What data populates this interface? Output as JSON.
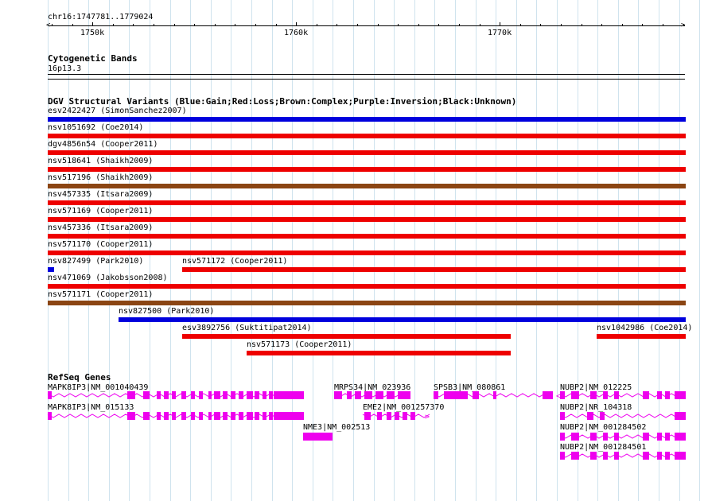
{
  "position": "chr16:1747781..1779024",
  "ruler": {
    "labels": [
      "1750k",
      "1760k",
      "1770k"
    ]
  },
  "cytoband": {
    "title": "Cytogenetic Bands",
    "band": "16p13.3"
  },
  "dgv": {
    "title": "DGV Structural Variants (Blue:Gain;Red:Loss;Brown:Complex;Purple:Inversion;Black:Unknown)",
    "colors": {
      "gain": "#0000dd",
      "loss": "#ee0000",
      "complex": "#8b4513"
    },
    "variants": [
      {
        "label": "esv2422427 (SimonSanchez2007)",
        "type": "gain"
      },
      {
        "label": "nsv1051692 (Coe2014)",
        "type": "loss"
      },
      {
        "label": "dgv4856n54 (Cooper2011)",
        "type": "loss"
      },
      {
        "label": "nsv518641 (Shaikh2009)",
        "type": "loss"
      },
      {
        "label": "nsv517196 (Shaikh2009)",
        "type": "complex"
      },
      {
        "label": "nsv457335 (Itsara2009)",
        "type": "loss"
      },
      {
        "label": "nsv571169 (Cooper2011)",
        "type": "loss"
      },
      {
        "label": "nsv457336 (Itsara2009)",
        "type": "loss"
      },
      {
        "label": "nsv571170 (Cooper2011)",
        "type": "loss"
      },
      {
        "label": "nsv827499 (Park2010)",
        "type": "gain"
      },
      {
        "label": "nsv571172 (Cooper2011)",
        "type": "loss"
      },
      {
        "label": "nsv471069 (Jakobsson2008)",
        "type": "loss"
      },
      {
        "label": "nsv571171 (Cooper2011)",
        "type": "complex"
      },
      {
        "label": "nsv827500 (Park2010)",
        "type": "gain"
      },
      {
        "label": "esv3892756 (Suktitipat2014)",
        "type": "loss"
      },
      {
        "label": "nsv1042986 (Coe2014)",
        "type": "loss"
      },
      {
        "label": "nsv571173 (Cooper2011)",
        "type": "loss"
      }
    ]
  },
  "refseq": {
    "title": "RefSeq Genes",
    "color": "#ee00ee",
    "genes": [
      {
        "label": "MAPK8IP3|NM_001040439"
      },
      {
        "label": "MAPK8IP3|NM_015133"
      },
      {
        "label": "MRPS34|NM_023936"
      },
      {
        "label": "SPSB3|NM_080861"
      },
      {
        "label": "NUBP2|NM_012225"
      },
      {
        "label": "EME2|NM_001257370"
      },
      {
        "label": "NUBP2|NR_104318"
      },
      {
        "label": "NME3|NM_002513"
      },
      {
        "label": "NUBP2|NM_001284502"
      },
      {
        "label": "NUBP2|NM_001284501"
      }
    ]
  }
}
